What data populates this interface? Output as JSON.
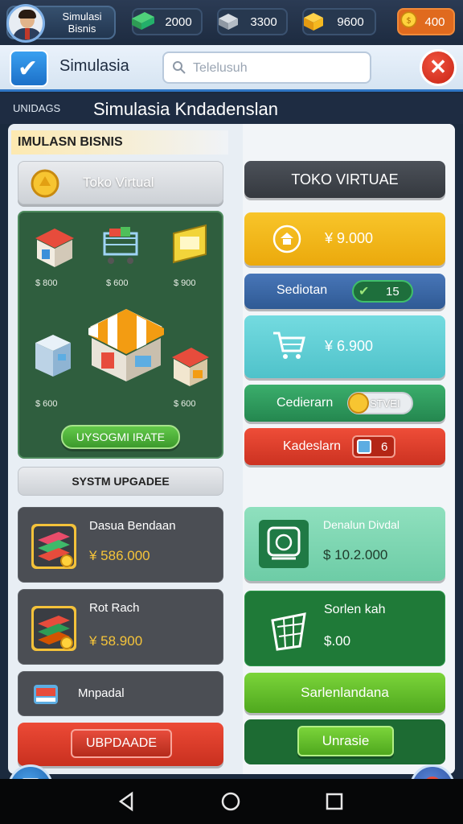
{
  "profile": {
    "name": "Simulasi Bisnis"
  },
  "resources": [
    {
      "icon": "cash-stack-icon",
      "value": "2000"
    },
    {
      "icon": "building-icon",
      "value": "3300"
    },
    {
      "icon": "crate-icon",
      "value": "9600"
    },
    {
      "icon": "gold-coin-icon",
      "value": "400"
    }
  ],
  "header": {
    "title": "Simulasia",
    "search_placeholder": "Telelusuh"
  },
  "strip": {
    "tag": "UNIDAGS",
    "title": "Simulasia Kndadenslan"
  },
  "left": {
    "section_label": "IMULASN BISNIS",
    "store_button": "Toko Virtual",
    "prices": [
      "$ 800",
      "$ 600",
      "$ 900",
      "$ 600",
      "$ 600"
    ],
    "action_button": "UYSOGMI IRATE",
    "upgrade_label": "SYSTM UPGADEE",
    "upgrades": [
      {
        "name": "Dasua Bendaan",
        "price": "¥ 586.000"
      },
      {
        "name": "Rot Rach",
        "price": "¥ 58.900"
      },
      {
        "name": "Mnpadal"
      }
    ],
    "upgrade_button": "UBPDAADE"
  },
  "right": {
    "store_title": "TOKO VIRTUAE",
    "yellow_card": "¥ 9.000",
    "blue_card": {
      "label": "Sediotan",
      "badge": "15"
    },
    "cyan_card": "¥ 6.900",
    "green_card": {
      "label": "Cedierarn",
      "badge": "STVEI"
    },
    "red_card": {
      "label": "Kadeslarn",
      "badge": "6"
    },
    "mint_card": {
      "title": "Denalun Divdal",
      "price": "$ 10.2.000"
    },
    "dark_card": {
      "title": "Sorlen kah",
      "price": "$.00"
    },
    "lime_button": "Sarlenlandana",
    "action_button": "Unrasie"
  },
  "colors": {
    "accent": "#2f76c4",
    "yellow": "#f5b911",
    "blue": "#3b65a3",
    "cyan": "#5fcfd6",
    "green": "#2f9a5e",
    "red": "#e0392a",
    "lime": "#6bc528"
  }
}
